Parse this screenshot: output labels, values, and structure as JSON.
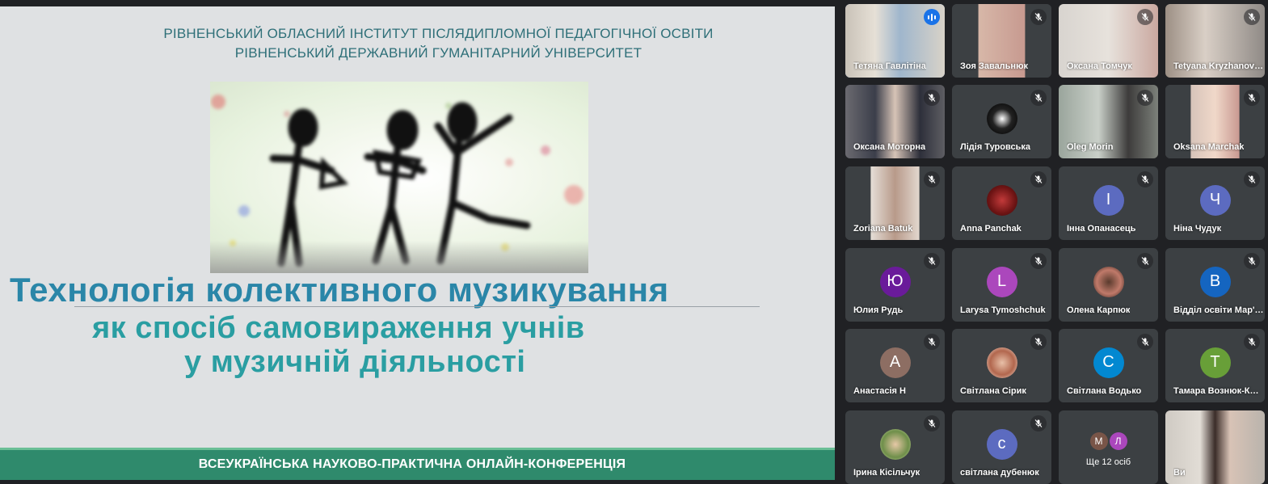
{
  "slide": {
    "org_line1": "РІВНЕНСЬКИЙ ОБЛАСНИЙ ІНСТИТУТ ПІСЛЯДИПЛОМНОЇ ПЕДАГОГІЧНОЇ ОСВІТИ",
    "org_line2": "РІВНЕНСЬКИЙ ДЕРЖАВНИЙ ГУМАНІТАРНИЙ УНІВЕРСИТЕТ",
    "title_line1": "Технологія колективного  музикування",
    "title_line2": "як спосіб самовираження учнів",
    "title_line3": "у музичній діяльності",
    "footer": "ВСЕУКРАЇНСЬКА НАУКОВО-ПРАКТИЧНА ОНЛАЙН-КОНФЕРЕНЦІЯ"
  },
  "participants": [
    {
      "name": "Тетяна Гавлітіна",
      "type": "video",
      "speaking": true
    },
    {
      "name": "Зоя Завальнюк",
      "type": "video"
    },
    {
      "name": "Оксана Томчук",
      "type": "video"
    },
    {
      "name": "Tetyana Kryzhanovska",
      "type": "video"
    },
    {
      "name": "Оксана Моторна",
      "type": "video"
    },
    {
      "name": "Лідія Туровська",
      "type": "photo"
    },
    {
      "name": "Oleg Morin",
      "type": "video"
    },
    {
      "name": "Oksana Marchak",
      "type": "video"
    },
    {
      "name": "Zoriana Batuk",
      "type": "video"
    },
    {
      "name": "Anna Panchak",
      "type": "photo"
    },
    {
      "name": "Інна Опанасець",
      "type": "initial",
      "initial": "І",
      "color": "#5c6bc0"
    },
    {
      "name": "Ніна Чудук",
      "type": "initial",
      "initial": "Ч",
      "color": "#5c6bc0"
    },
    {
      "name": "Юлия Рудь",
      "type": "initial",
      "initial": "Ю",
      "color": "#6a1b9a"
    },
    {
      "name": "Larysa Tymoshchuk",
      "type": "initial",
      "initial": "L",
      "color": "#ab47bc"
    },
    {
      "name": "Олена Карпюк",
      "type": "photo"
    },
    {
      "name": "Відділ освіти Мар'янівської ТГ",
      "type": "initial",
      "initial": "В",
      "color": "#1565c0"
    },
    {
      "name": "Анастасія Н",
      "type": "initial",
      "initial": "А",
      "color": "#8d6e63"
    },
    {
      "name": "Світлана Сірик",
      "type": "photo"
    },
    {
      "name": "Світлана Водько",
      "type": "initial",
      "initial": "С",
      "color": "#0288d1"
    },
    {
      "name": "Тамара Вознюк-Козловська",
      "type": "initial",
      "initial": "Т",
      "color": "#689f38"
    },
    {
      "name": "Ірина Кісільчук",
      "type": "photo"
    },
    {
      "name": "світлана дубенюк",
      "type": "initial",
      "initial": "с",
      "color": "#5c6bc0"
    },
    {
      "name": "",
      "type": "more",
      "label": "Ще 12 осіб",
      "initials": [
        "М",
        "Л"
      ],
      "colors": [
        "#795548",
        "#ab47bc"
      ]
    },
    {
      "name": "Ви",
      "type": "video"
    }
  ]
}
